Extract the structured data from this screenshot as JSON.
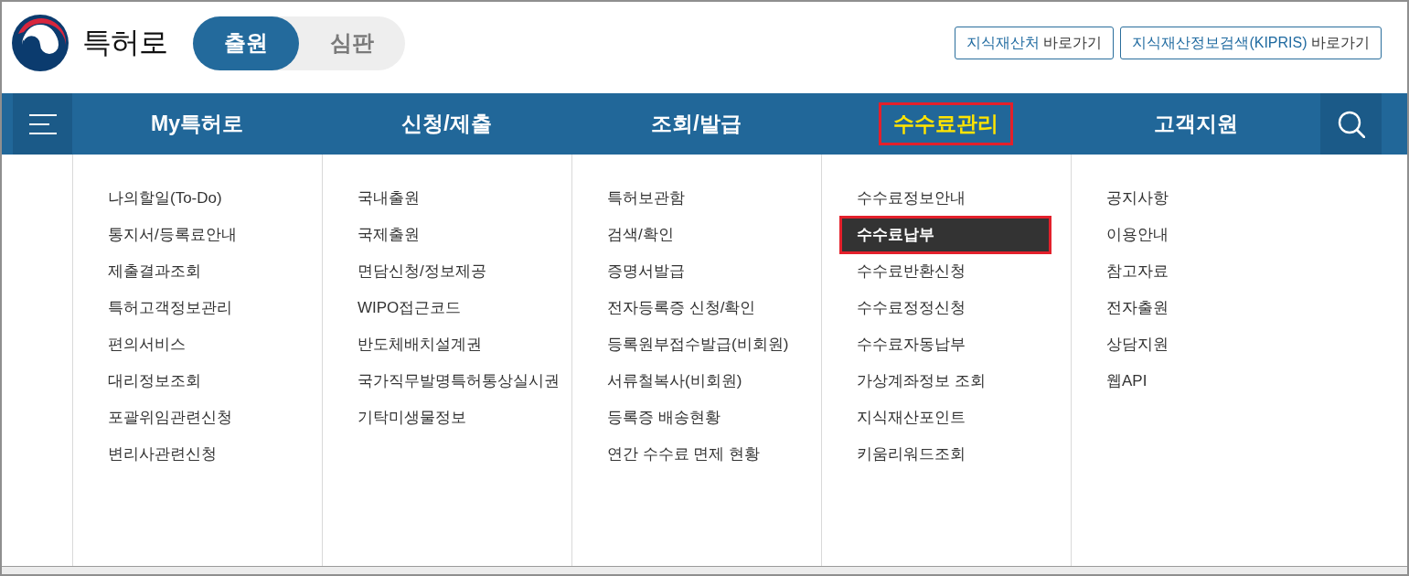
{
  "header": {
    "logo_text": "특허로",
    "mode_tabs": [
      {
        "label": "출원",
        "selected": true
      },
      {
        "label": "심판",
        "selected": false
      }
    ],
    "links": [
      {
        "name": "지식재산처",
        "suffix": "바로가기"
      },
      {
        "name": "지식재산정보검색(KIPRIS)",
        "suffix": "바로가기"
      }
    ]
  },
  "nav": {
    "items": [
      {
        "label": "My특허로",
        "selected": false,
        "highlighted": false
      },
      {
        "label": "신청/제출",
        "selected": false,
        "highlighted": false
      },
      {
        "label": "조회/발급",
        "selected": false,
        "highlighted": false
      },
      {
        "label": "수수료관리",
        "selected": true,
        "highlighted": true
      },
      {
        "label": "고객지원",
        "selected": false,
        "highlighted": false
      }
    ]
  },
  "menu": {
    "columns": [
      {
        "items": [
          {
            "label": "나의할일(To-Do)",
            "selected": false,
            "highlighted": false
          },
          {
            "label": "통지서/등록료안내",
            "selected": false,
            "highlighted": false
          },
          {
            "label": "제출결과조회",
            "selected": false,
            "highlighted": false
          },
          {
            "label": "특허고객정보관리",
            "selected": false,
            "highlighted": false
          },
          {
            "label": "편의서비스",
            "selected": false,
            "highlighted": false
          },
          {
            "label": "대리정보조회",
            "selected": false,
            "highlighted": false
          },
          {
            "label": "포괄위임관련신청",
            "selected": false,
            "highlighted": false
          },
          {
            "label": "변리사관련신청",
            "selected": false,
            "highlighted": false
          }
        ]
      },
      {
        "items": [
          {
            "label": "국내출원",
            "selected": false,
            "highlighted": false
          },
          {
            "label": "국제출원",
            "selected": false,
            "highlighted": false
          },
          {
            "label": "면담신청/정보제공",
            "selected": false,
            "highlighted": false
          },
          {
            "label": "WIPO접근코드",
            "selected": false,
            "highlighted": false
          },
          {
            "label": "반도체배치설계권",
            "selected": false,
            "highlighted": false
          },
          {
            "label": "국가직무발명특허통상실시권",
            "selected": false,
            "highlighted": false
          },
          {
            "label": "기탁미생물정보",
            "selected": false,
            "highlighted": false
          }
        ]
      },
      {
        "items": [
          {
            "label": "특허보관함",
            "selected": false,
            "highlighted": false
          },
          {
            "label": "검색/확인",
            "selected": false,
            "highlighted": false
          },
          {
            "label": "증명서발급",
            "selected": false,
            "highlighted": false
          },
          {
            "label": "전자등록증 신청/확인",
            "selected": false,
            "highlighted": false
          },
          {
            "label": "등록원부접수발급(비회원)",
            "selected": false,
            "highlighted": false
          },
          {
            "label": "서류철복사(비회원)",
            "selected": false,
            "highlighted": false
          },
          {
            "label": "등록증 배송현황",
            "selected": false,
            "highlighted": false
          },
          {
            "label": "연간 수수료 면제 현황",
            "selected": false,
            "highlighted": false
          }
        ]
      },
      {
        "items": [
          {
            "label": "수수료정보안내",
            "selected": false,
            "highlighted": false
          },
          {
            "label": "수수료납부",
            "selected": true,
            "highlighted": true
          },
          {
            "label": "수수료반환신청",
            "selected": false,
            "highlighted": false
          },
          {
            "label": "수수료정정신청",
            "selected": false,
            "highlighted": false
          },
          {
            "label": "수수료자동납부",
            "selected": false,
            "highlighted": false
          },
          {
            "label": "가상계좌정보 조회",
            "selected": false,
            "highlighted": false
          },
          {
            "label": "지식재산포인트",
            "selected": false,
            "highlighted": false
          },
          {
            "label": "키움리워드조회",
            "selected": false,
            "highlighted": false
          }
        ]
      },
      {
        "items": [
          {
            "label": "공지사항",
            "selected": false,
            "highlighted": false
          },
          {
            "label": "이용안내",
            "selected": false,
            "highlighted": false
          },
          {
            "label": "참고자료",
            "selected": false,
            "highlighted": false
          },
          {
            "label": "전자출원",
            "selected": false,
            "highlighted": false
          },
          {
            "label": "상담지원",
            "selected": false,
            "highlighted": false
          },
          {
            "label": "웹API",
            "selected": false,
            "highlighted": false
          }
        ]
      }
    ]
  }
}
